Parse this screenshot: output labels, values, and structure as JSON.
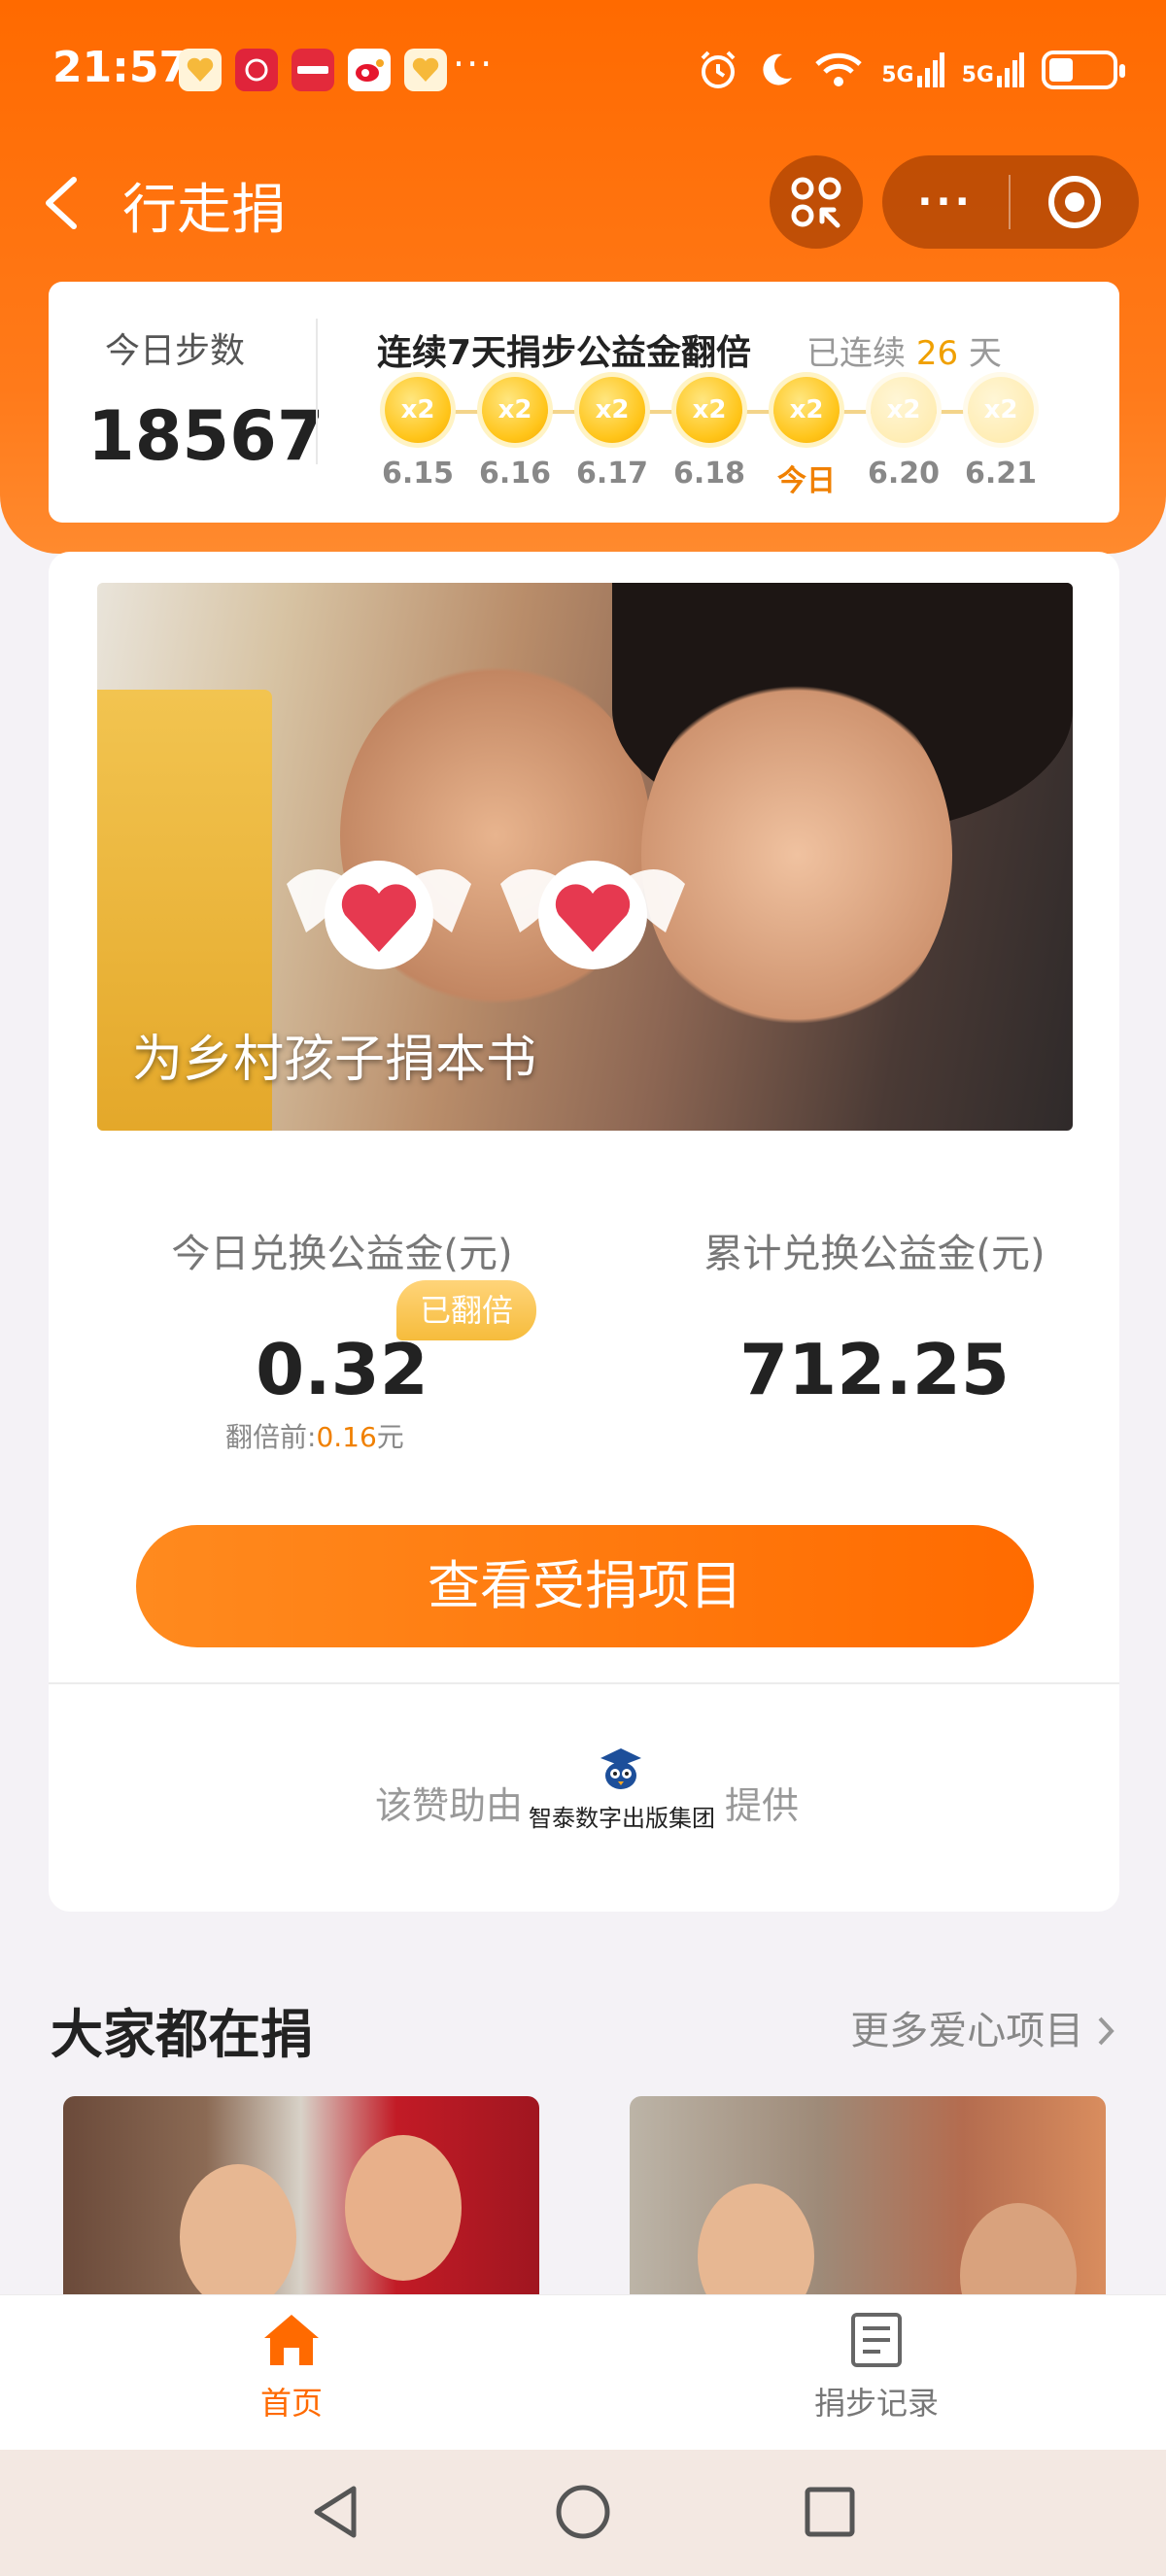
{
  "status_bar": {
    "time": "21:57",
    "more": "···",
    "net1": "5G",
    "net2": "5G"
  },
  "nav": {
    "title": "行走捐"
  },
  "steps": {
    "label": "今日步数",
    "value": "18567",
    "streak_title": "连续7天捐步公益金翻倍",
    "streak_prefix": "已连续",
    "streak_days": "26",
    "streak_suffix": "天",
    "multiplier": "x2",
    "days": [
      {
        "label": "6.15",
        "done": true
      },
      {
        "label": "6.16",
        "done": true
      },
      {
        "label": "6.17",
        "done": true
      },
      {
        "label": "6.18",
        "done": true
      },
      {
        "label": "今日",
        "done": true,
        "today": true
      },
      {
        "label": "6.20",
        "done": false
      },
      {
        "label": "6.21",
        "done": false
      }
    ]
  },
  "banner": {
    "title": "为乡村孩子捐本书"
  },
  "stats": {
    "today_label": "今日兑换公益金(元)",
    "today_value": "0.32",
    "doubled_badge": "已翻倍",
    "before_label": "翻倍前:",
    "before_value": "0.16",
    "before_unit": "元",
    "total_label": "累计兑换公益金(元)",
    "total_value": "712.25"
  },
  "cta": {
    "label": "查看受捐项目"
  },
  "sponsor": {
    "prefix": "该赞助由",
    "name": "智泰数字出版集团",
    "suffix": "提供"
  },
  "section": {
    "title": "大家都在捐",
    "more": "更多爱心项目"
  },
  "tabbar": {
    "home": "首页",
    "records": "捐步记录"
  },
  "colors": {
    "accent": "#ff6a00",
    "gold": "#f6bc3c",
    "today": "#f08000"
  }
}
